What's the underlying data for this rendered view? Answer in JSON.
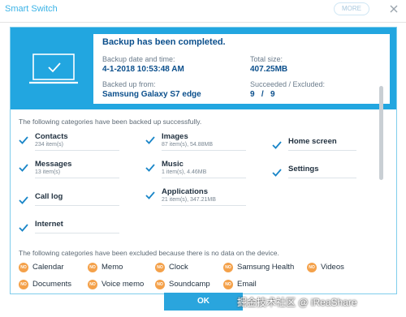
{
  "window": {
    "title": "Smart Switch",
    "more_label": "MORE"
  },
  "banner": {
    "headline": "Backup has been completed.",
    "date_label": "Backup date and time:",
    "date_value": "4-1-2018 10:53:48 AM",
    "from_label": "Backed up from:",
    "from_value": "Samsung Galaxy S7 edge",
    "size_label": "Total size:",
    "size_value": "407.25MB",
    "result_label": "Succeeded / Excluded:",
    "result_value": "9   /   9"
  },
  "backed_up": {
    "title": "The following categories have been backed up successfully.",
    "items": [
      {
        "name": "Contacts",
        "meta": "234 item(s)"
      },
      {
        "name": "Images",
        "meta": "87 item(s), 54.88MB"
      },
      {
        "name": "Home screen",
        "meta": ""
      },
      {
        "name": "Messages",
        "meta": "13 item(s)"
      },
      {
        "name": "Music",
        "meta": "1 item(s), 4.46MB"
      },
      {
        "name": "Settings",
        "meta": ""
      },
      {
        "name": "Call log",
        "meta": ""
      },
      {
        "name": "Applications",
        "meta": "21 item(s), 347.21MB"
      },
      {
        "name": "Internet",
        "meta": ""
      }
    ]
  },
  "excluded": {
    "title": "The following categories have been excluded because there is no data on the device.",
    "icon_text": "NO",
    "items": [
      "Calendar",
      "Memo",
      "Clock",
      "Samsung Health",
      "Videos",
      "Documents",
      "Voice memo",
      "Soundcamp",
      "Email"
    ]
  },
  "ok_label": "OK",
  "watermark": "掘金技术社区 @ iReaShare",
  "colors": {
    "accent": "#22a6e0",
    "headline": "#0b4f8c",
    "check": "#1a86c8",
    "excluded_icon": "#f4a14a"
  }
}
